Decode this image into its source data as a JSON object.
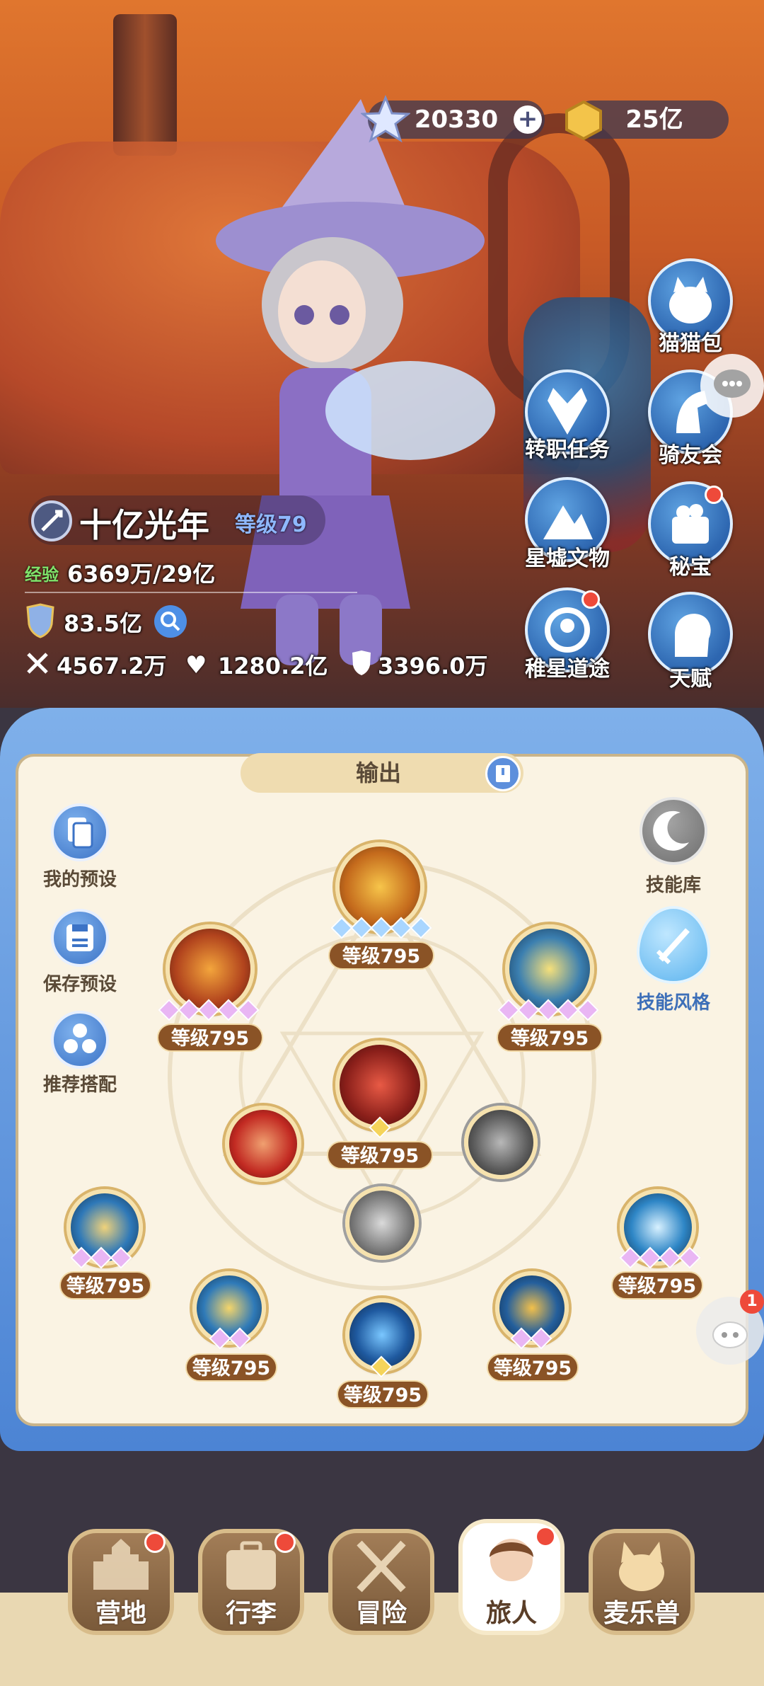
{
  "currency": {
    "stars": "20330",
    "gold": "25亿"
  },
  "right_menu": [
    {
      "label": "猫猫包",
      "icon": "cat-bag-icon",
      "badge": false
    },
    {
      "label": "骑友会",
      "icon": "horse-icon",
      "badge": false
    },
    {
      "label": "转职任务",
      "icon": "fox-icon",
      "badge": false
    },
    {
      "label": "秘宝",
      "icon": "treasure-icon",
      "badge": true
    },
    {
      "label": "星墟文物",
      "icon": "mountain-icon",
      "badge": false
    },
    {
      "label": "天赋",
      "icon": "brain-head-icon",
      "badge": false
    },
    {
      "label": "稚星道途",
      "icon": "star-path-icon",
      "badge": true
    }
  ],
  "player": {
    "name": "十亿光年",
    "level": "等级79",
    "exp_label": "经验",
    "exp_value": "6369万/29亿",
    "power": "83.5亿",
    "attack": "4567.2万",
    "hp": "1280.2亿",
    "defense": "3396.0万"
  },
  "panel": {
    "tab_label": "输出",
    "left_buttons": [
      "我的预设",
      "保存预设",
      "推荐搭配"
    ],
    "skill_library": "技能库",
    "skill_style": "技能风格",
    "skill_levels": [
      "等级795",
      "等级795",
      "等级795",
      "等级795",
      "等级795",
      "等级795",
      "等级795",
      "等级795",
      "等级795",
      "等级795"
    ]
  },
  "nav": [
    {
      "label": "营地",
      "badge": true,
      "active": false
    },
    {
      "label": "行李",
      "badge": true,
      "active": false
    },
    {
      "label": "冒险",
      "badge": false,
      "active": false
    },
    {
      "label": "旅人",
      "badge": true,
      "active": true
    },
    {
      "label": "麦乐兽",
      "badge": false,
      "active": false
    }
  ],
  "float_badge": "1",
  "colors": {
    "accent": "#4c84d4",
    "level_pill": "#8a5326",
    "badge": "#ee4a3a"
  }
}
